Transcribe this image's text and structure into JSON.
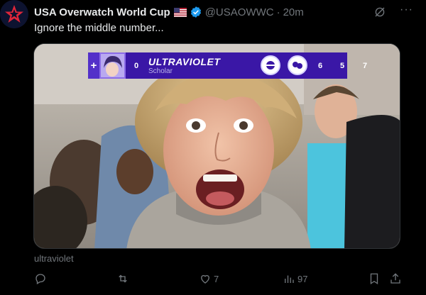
{
  "post": {
    "author_name": "USA Overwatch World Cup",
    "handle": "@USAOWWC",
    "separator": "·",
    "time": "20m",
    "text": "Ignore the middle number...",
    "more_label": "···"
  },
  "media": {
    "caption": "ultraviolet",
    "overlay": {
      "plus": "+",
      "rank": "0",
      "player": "ULTRAVIOLET",
      "role": "Scholar",
      "stats": [
        "6",
        "5",
        "7"
      ]
    }
  },
  "actions": {
    "reply": "",
    "repost": "",
    "likes": "7",
    "views": "97"
  },
  "colors": {
    "background": "#000000",
    "text": "#e7e9ea",
    "muted": "#71767b",
    "verified": "#1d9bf0",
    "overlay_bar": "#3a17a6"
  }
}
